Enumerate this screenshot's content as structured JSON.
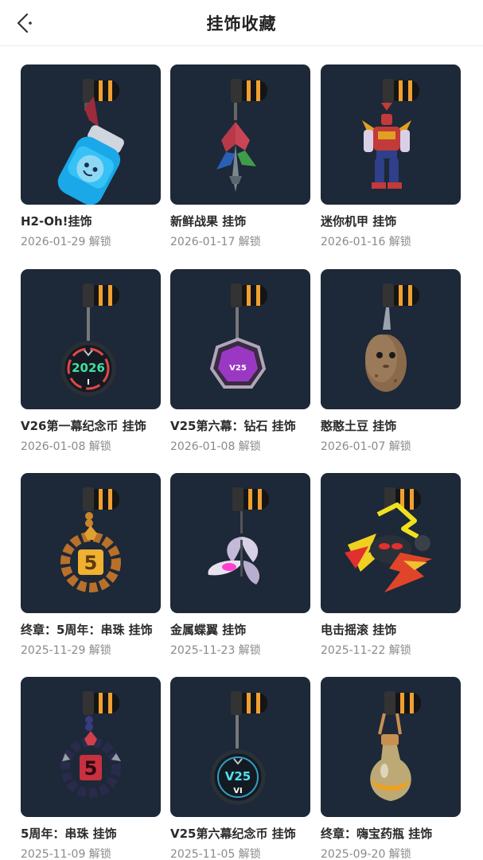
{
  "header": {
    "title": "挂饰收藏",
    "back_icon": "chevron-left-icon"
  },
  "unlock_suffix": "解锁",
  "colors": {
    "thumb_bg": "#1d2838",
    "clip_orange": "#f0a030"
  },
  "items": [
    {
      "name": "H2-Oh!挂饰",
      "date": "2026-01-29 解锁",
      "icon": "water-bottle-icon"
    },
    {
      "name": "新鲜战果 挂饰",
      "date": "2026-01-17 解锁",
      "icon": "leaf-sword-icon"
    },
    {
      "name": "迷你机甲 挂饰",
      "date": "2026-01-16 解锁",
      "icon": "mini-mech-icon"
    },
    {
      "name": "V26第一幕纪念币 挂饰",
      "date": "2026-01-08 解锁",
      "icon": "coin-2026-icon",
      "badge_text": "2026",
      "badge_sub": "I"
    },
    {
      "name": "V25第六幕：钻石 挂饰",
      "date": "2026-01-08 解锁",
      "icon": "diamond-badge-icon",
      "badge_text": "V25"
    },
    {
      "name": "憨憨土豆 挂饰",
      "date": "2026-01-07 解锁",
      "icon": "potato-icon"
    },
    {
      "name": "终章：5周年：串珠 挂饰",
      "date": "2025-11-29 解锁",
      "icon": "gold-bead-ring-icon",
      "badge_text": "5"
    },
    {
      "name": "金属蝶翼 挂饰",
      "date": "2025-11-23 解锁",
      "icon": "metal-butterfly-icon"
    },
    {
      "name": "电击摇滚 挂饰",
      "date": "2025-11-22 解锁",
      "icon": "lightning-rock-icon"
    },
    {
      "name": "5周年：串珠 挂饰",
      "date": "2025-11-09 解锁",
      "icon": "red-bead-ring-icon",
      "badge_text": "5"
    },
    {
      "name": "V25第六幕纪念币 挂饰",
      "date": "2025-11-05 解锁",
      "icon": "coin-v25-icon",
      "badge_text": "V25",
      "badge_sub": "VI"
    },
    {
      "name": "终章：嗨宝药瓶 挂饰",
      "date": "2025-09-20 解锁",
      "icon": "potion-flask-icon"
    }
  ]
}
